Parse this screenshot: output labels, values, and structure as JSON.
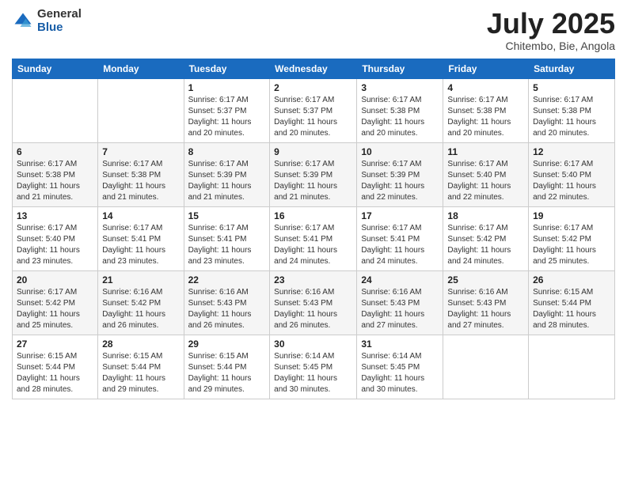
{
  "logo": {
    "general": "General",
    "blue": "Blue"
  },
  "title": "July 2025",
  "subtitle": "Chitembo, Bie, Angola",
  "days_header": [
    "Sunday",
    "Monday",
    "Tuesday",
    "Wednesday",
    "Thursday",
    "Friday",
    "Saturday"
  ],
  "weeks": [
    [
      {
        "day": "",
        "info": ""
      },
      {
        "day": "",
        "info": ""
      },
      {
        "day": "1",
        "info": "Sunrise: 6:17 AM\nSunset: 5:37 PM\nDaylight: 11 hours and 20 minutes."
      },
      {
        "day": "2",
        "info": "Sunrise: 6:17 AM\nSunset: 5:37 PM\nDaylight: 11 hours and 20 minutes."
      },
      {
        "day": "3",
        "info": "Sunrise: 6:17 AM\nSunset: 5:38 PM\nDaylight: 11 hours and 20 minutes."
      },
      {
        "day": "4",
        "info": "Sunrise: 6:17 AM\nSunset: 5:38 PM\nDaylight: 11 hours and 20 minutes."
      },
      {
        "day": "5",
        "info": "Sunrise: 6:17 AM\nSunset: 5:38 PM\nDaylight: 11 hours and 20 minutes."
      }
    ],
    [
      {
        "day": "6",
        "info": "Sunrise: 6:17 AM\nSunset: 5:38 PM\nDaylight: 11 hours and 21 minutes."
      },
      {
        "day": "7",
        "info": "Sunrise: 6:17 AM\nSunset: 5:38 PM\nDaylight: 11 hours and 21 minutes."
      },
      {
        "day": "8",
        "info": "Sunrise: 6:17 AM\nSunset: 5:39 PM\nDaylight: 11 hours and 21 minutes."
      },
      {
        "day": "9",
        "info": "Sunrise: 6:17 AM\nSunset: 5:39 PM\nDaylight: 11 hours and 21 minutes."
      },
      {
        "day": "10",
        "info": "Sunrise: 6:17 AM\nSunset: 5:39 PM\nDaylight: 11 hours and 22 minutes."
      },
      {
        "day": "11",
        "info": "Sunrise: 6:17 AM\nSunset: 5:40 PM\nDaylight: 11 hours and 22 minutes."
      },
      {
        "day": "12",
        "info": "Sunrise: 6:17 AM\nSunset: 5:40 PM\nDaylight: 11 hours and 22 minutes."
      }
    ],
    [
      {
        "day": "13",
        "info": "Sunrise: 6:17 AM\nSunset: 5:40 PM\nDaylight: 11 hours and 23 minutes."
      },
      {
        "day": "14",
        "info": "Sunrise: 6:17 AM\nSunset: 5:41 PM\nDaylight: 11 hours and 23 minutes."
      },
      {
        "day": "15",
        "info": "Sunrise: 6:17 AM\nSunset: 5:41 PM\nDaylight: 11 hours and 23 minutes."
      },
      {
        "day": "16",
        "info": "Sunrise: 6:17 AM\nSunset: 5:41 PM\nDaylight: 11 hours and 24 minutes."
      },
      {
        "day": "17",
        "info": "Sunrise: 6:17 AM\nSunset: 5:41 PM\nDaylight: 11 hours and 24 minutes."
      },
      {
        "day": "18",
        "info": "Sunrise: 6:17 AM\nSunset: 5:42 PM\nDaylight: 11 hours and 24 minutes."
      },
      {
        "day": "19",
        "info": "Sunrise: 6:17 AM\nSunset: 5:42 PM\nDaylight: 11 hours and 25 minutes."
      }
    ],
    [
      {
        "day": "20",
        "info": "Sunrise: 6:17 AM\nSunset: 5:42 PM\nDaylight: 11 hours and 25 minutes."
      },
      {
        "day": "21",
        "info": "Sunrise: 6:16 AM\nSunset: 5:42 PM\nDaylight: 11 hours and 26 minutes."
      },
      {
        "day": "22",
        "info": "Sunrise: 6:16 AM\nSunset: 5:43 PM\nDaylight: 11 hours and 26 minutes."
      },
      {
        "day": "23",
        "info": "Sunrise: 6:16 AM\nSunset: 5:43 PM\nDaylight: 11 hours and 26 minutes."
      },
      {
        "day": "24",
        "info": "Sunrise: 6:16 AM\nSunset: 5:43 PM\nDaylight: 11 hours and 27 minutes."
      },
      {
        "day": "25",
        "info": "Sunrise: 6:16 AM\nSunset: 5:43 PM\nDaylight: 11 hours and 27 minutes."
      },
      {
        "day": "26",
        "info": "Sunrise: 6:15 AM\nSunset: 5:44 PM\nDaylight: 11 hours and 28 minutes."
      }
    ],
    [
      {
        "day": "27",
        "info": "Sunrise: 6:15 AM\nSunset: 5:44 PM\nDaylight: 11 hours and 28 minutes."
      },
      {
        "day": "28",
        "info": "Sunrise: 6:15 AM\nSunset: 5:44 PM\nDaylight: 11 hours and 29 minutes."
      },
      {
        "day": "29",
        "info": "Sunrise: 6:15 AM\nSunset: 5:44 PM\nDaylight: 11 hours and 29 minutes."
      },
      {
        "day": "30",
        "info": "Sunrise: 6:14 AM\nSunset: 5:45 PM\nDaylight: 11 hours and 30 minutes."
      },
      {
        "day": "31",
        "info": "Sunrise: 6:14 AM\nSunset: 5:45 PM\nDaylight: 11 hours and 30 minutes."
      },
      {
        "day": "",
        "info": ""
      },
      {
        "day": "",
        "info": ""
      }
    ]
  ]
}
